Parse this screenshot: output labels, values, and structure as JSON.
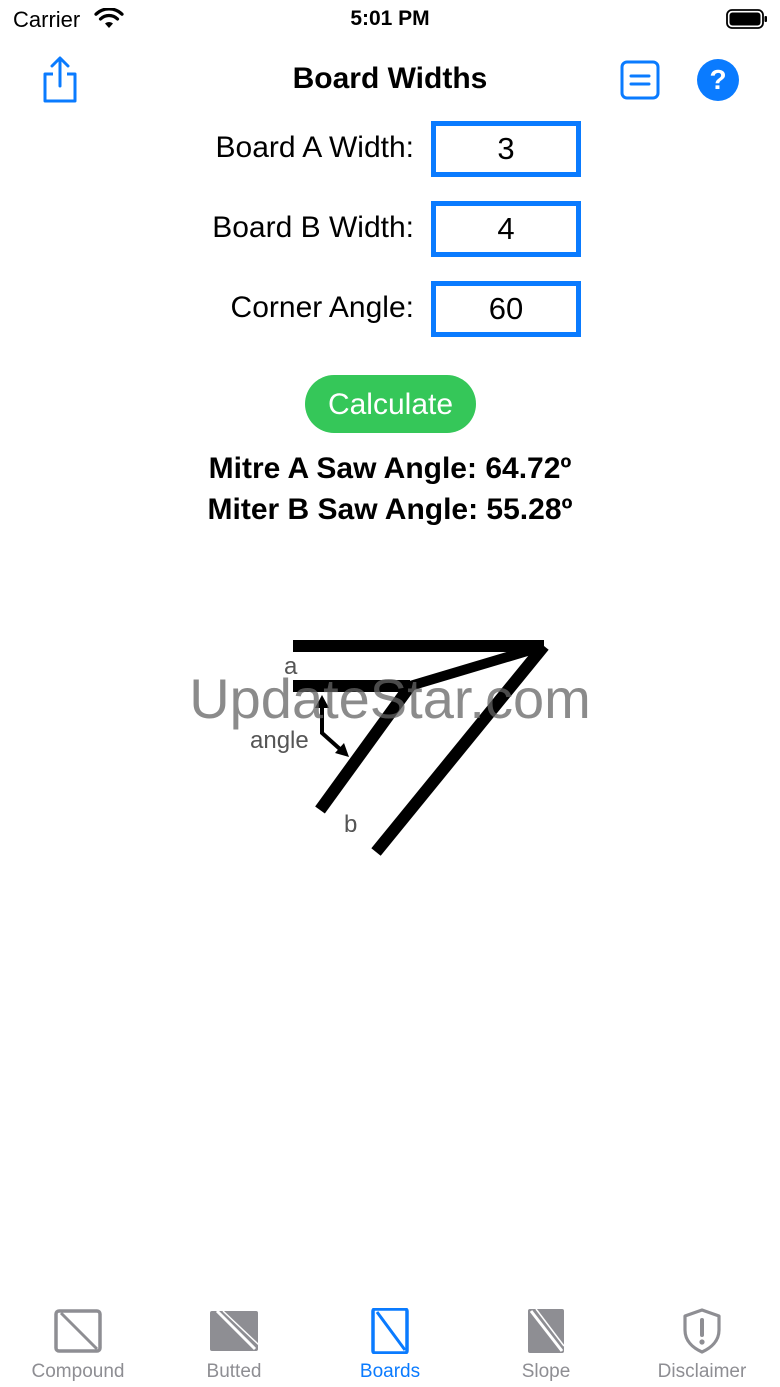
{
  "status_bar": {
    "carrier": "Carrier",
    "time": "5:01 PM"
  },
  "nav": {
    "title": "Board Widths",
    "share_icon": "share-icon",
    "list_icon": "list-icon",
    "help_label": "?"
  },
  "form": {
    "board_a": {
      "label": "Board A Width:",
      "value": "3"
    },
    "board_b": {
      "label": "Board B Width:",
      "value": "4"
    },
    "corner_angle": {
      "label": "Corner Angle:",
      "value": "60"
    },
    "calculate_label": "Calculate"
  },
  "results": {
    "mitre_a": "Mitre A Saw Angle: 64.72º",
    "miter_b": "Miter B Saw Angle: 55.28º"
  },
  "diagram": {
    "label_a": "a",
    "label_b": "b",
    "label_angle": "angle"
  },
  "watermark": "UpdateStar.com",
  "colors": {
    "accent": "#0a7bff",
    "calculate": "#35c759",
    "inactive": "#8e8e93"
  },
  "tabs": [
    {
      "label": "Compound",
      "icon": "square-slash-icon",
      "active": false
    },
    {
      "label": "Butted",
      "icon": "filled-square-slash-icon",
      "active": false
    },
    {
      "label": "Boards",
      "icon": "rect-slash-icon",
      "active": true
    },
    {
      "label": "Slope",
      "icon": "filled-rect-slash-icon",
      "active": false
    },
    {
      "label": "Disclaimer",
      "icon": "shield-exclamation-icon",
      "active": false
    }
  ]
}
